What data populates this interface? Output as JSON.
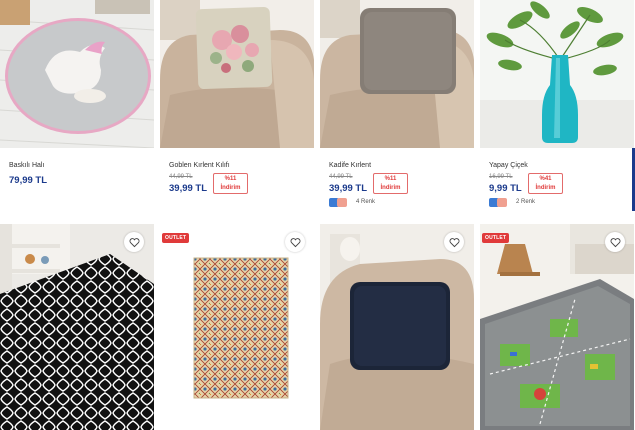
{
  "products": [
    {
      "name": "Baskılı Halı",
      "price": "79,99 TL"
    },
    {
      "name": "Goblen Kırlent Kılıfı",
      "old_price": "44,99 TL",
      "price": "39,99 TL",
      "discount_pct": "%11",
      "discount_word": "İndirim"
    },
    {
      "name": "Kadife Kırlent",
      "old_price": "44,99 TL",
      "price": "39,99 TL",
      "discount_pct": "%11",
      "discount_word": "İndirim",
      "colors_label": "4 Renk",
      "swatches": [
        "#3b7bd4",
        "#f0a090"
      ]
    },
    {
      "name": "Yapay Çiçek",
      "old_price": "16,99 TL",
      "price": "9,99 TL",
      "discount_pct": "%41",
      "discount_word": "İndirim",
      "colors_label": "2 Renk",
      "swatches": [
        "#3b7bd4",
        "#f0a090"
      ]
    }
  ],
  "second_row": {
    "outlet_label": "OUTLET"
  },
  "colors": {
    "price": "#1b3a8c",
    "discount": "#e03a3a",
    "accent": "#1b3a8c"
  },
  "icons": {
    "favorite": "heart-outline-icon"
  }
}
